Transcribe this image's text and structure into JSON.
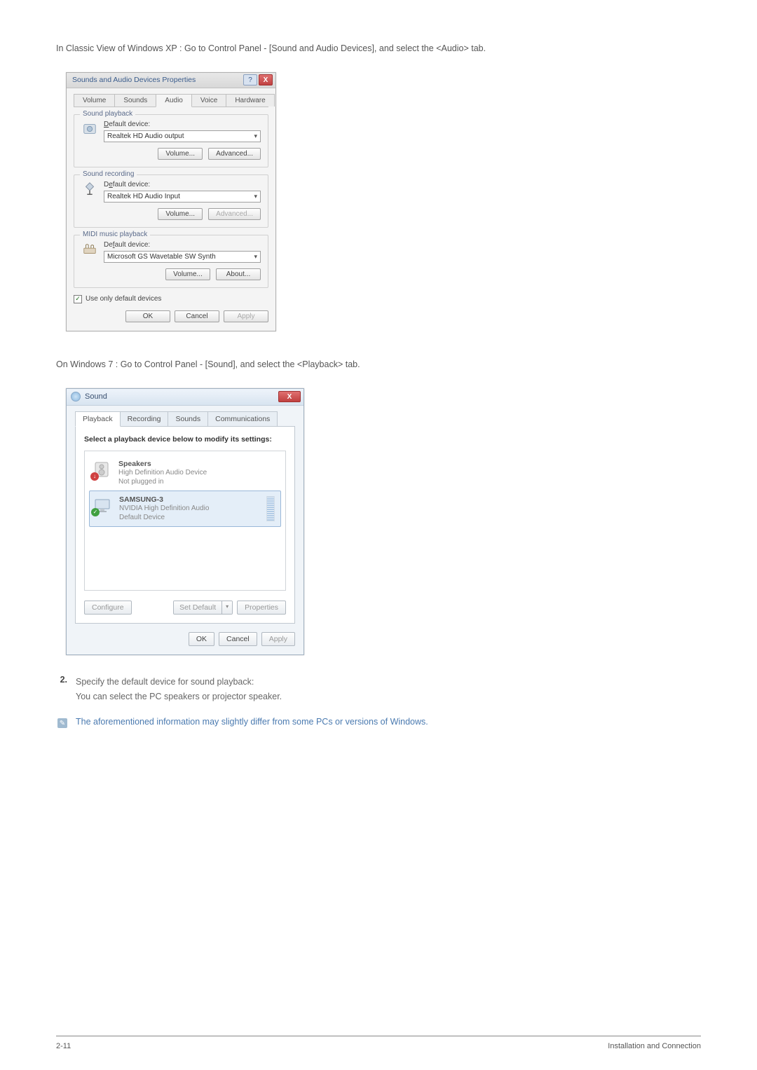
{
  "intro_xp": "In Classic View of Windows XP : Go to Control Panel - [Sound and Audio Devices], and select the <Audio> tab.",
  "intro_w7": "On Windows 7 : Go to Control Panel - [Sound], and select the <Playback> tab.",
  "xp_dialog": {
    "title": "Sounds and Audio Devices Properties",
    "help": "?",
    "close": "X",
    "tabs": [
      "Volume",
      "Sounds",
      "Audio",
      "Voice",
      "Hardware"
    ],
    "playback": {
      "legend": "Sound playback",
      "label": "Default device:",
      "value": "Realtek HD Audio output",
      "volume": "Volume...",
      "advanced": "Advanced..."
    },
    "recording": {
      "legend": "Sound recording",
      "label": "Default device:",
      "value": "Realtek HD Audio Input",
      "volume": "Volume...",
      "advanced": "Advanced..."
    },
    "midi": {
      "legend": "MIDI music playback",
      "label": "Default device:",
      "value": "Microsoft GS Wavetable SW Synth",
      "volume": "Volume...",
      "about": "About..."
    },
    "checkbox": "Use only default devices",
    "ok": "OK",
    "cancel": "Cancel",
    "apply": "Apply"
  },
  "w7_dialog": {
    "title": "Sound",
    "close": "X",
    "tabs": [
      "Playback",
      "Recording",
      "Sounds",
      "Communications"
    ],
    "instruction": "Select a playback device below to modify its settings:",
    "items": [
      {
        "name": "Speakers",
        "desc1": "High Definition Audio Device",
        "desc2": "Not plugged in"
      },
      {
        "name": "SAMSUNG-3",
        "desc1": "NVIDIA High Definition Audio",
        "desc2": "Default Device"
      }
    ],
    "configure": "Configure",
    "set_default": "Set Default",
    "properties": "Properties",
    "ok": "OK",
    "cancel": "Cancel",
    "apply": "Apply"
  },
  "step": {
    "num": "2.",
    "line1": "Specify the default device for sound playback:",
    "line2": "You can select the PC speakers or projector speaker."
  },
  "note": "The aforementioned information may slightly differ from some PCs or versions of Windows.",
  "footer": {
    "left": "2-11",
    "right": "Installation and Connection"
  }
}
